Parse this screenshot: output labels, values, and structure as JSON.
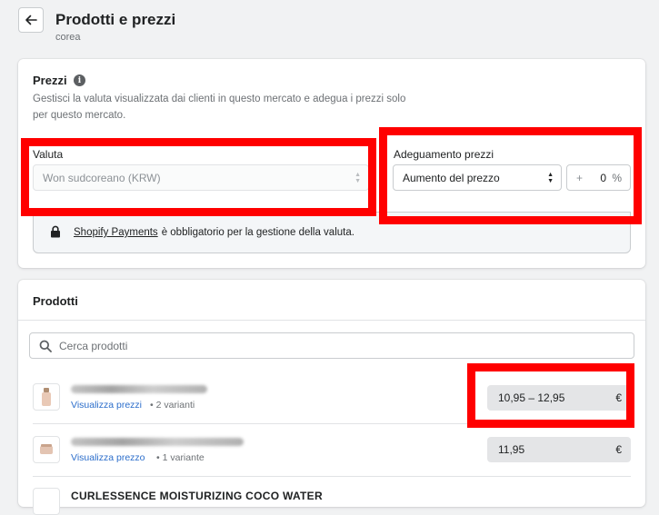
{
  "header": {
    "title": "Prodotti e prezzi",
    "subtitle": "corea"
  },
  "prices": {
    "title": "Prezzi",
    "description": "Gestisci la valuta visualizzata dai clienti in questo mercato e adegua i prezzi solo per questo mercato.",
    "currency_label": "Valuta",
    "currency_value": "Won sudcoreano (KRW)",
    "adjustment_label": "Adeguamento prezzi",
    "adjustment_value": "Aumento del prezzo",
    "adjustment_sign": "+",
    "adjustment_percent": "0",
    "percent_symbol": "%",
    "notice_link": "Shopify Payments",
    "notice_text": "è obbligatorio per la gestione della valuta."
  },
  "products": {
    "title": "Prodotti",
    "search_placeholder": "Cerca prodotti",
    "items": [
      {
        "link": "Visualizza prezzi",
        "meta": "2 varianti",
        "price": "10,95 – 12,95",
        "currency": "€"
      },
      {
        "link": "Visualizza prezzo",
        "meta": "1 variante",
        "price": "11,95",
        "currency": "€"
      },
      {
        "name": "CURLESSENCE MOISTURIZING COCO WATER"
      }
    ]
  },
  "colors": {
    "highlight": "#ff0000",
    "link": "#2c6ecb",
    "background": "#f1f2f3"
  }
}
